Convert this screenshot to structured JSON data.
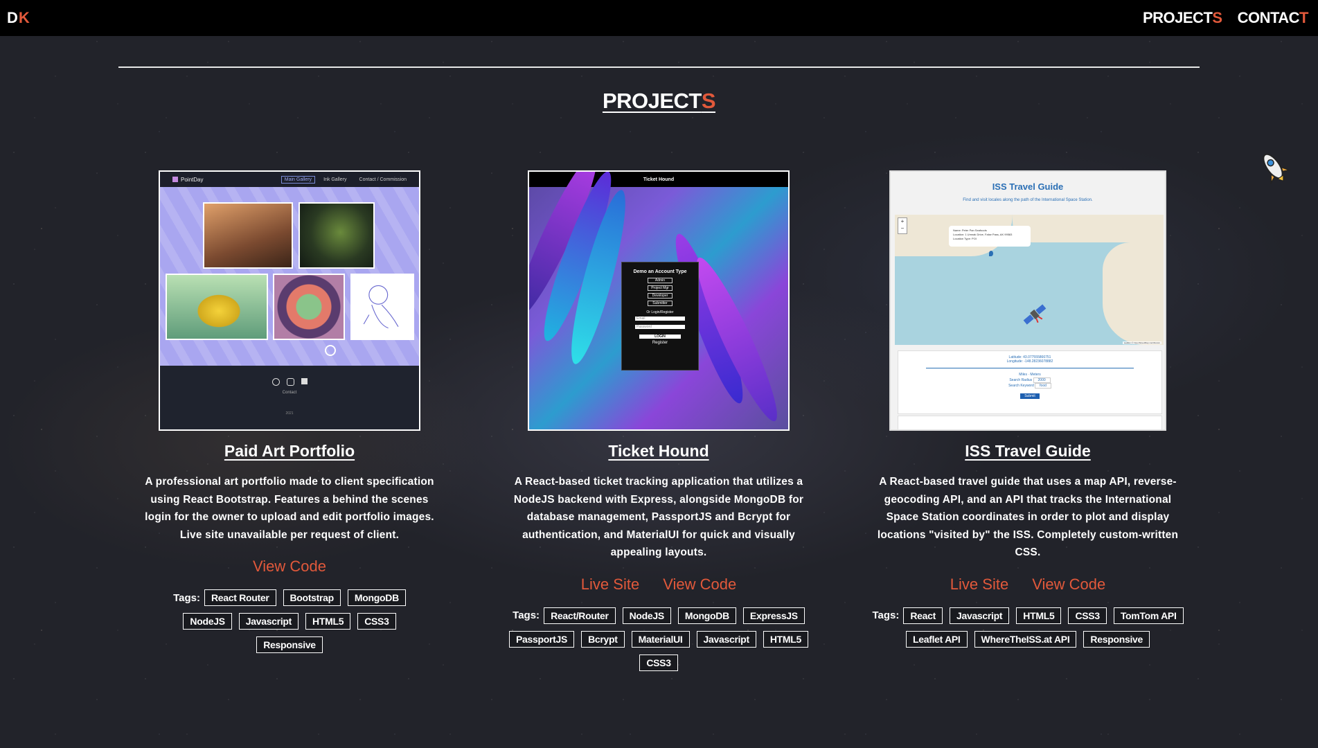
{
  "nav": {
    "logo_first": "D",
    "logo_second": "K",
    "projects_main": "PROJECT",
    "projects_end": "S",
    "contact_main": "CONTAC",
    "contact_end": "T"
  },
  "section": {
    "title_main": "PROJECT",
    "title_end": "S"
  },
  "colors": {
    "accent": "#e2593b",
    "nav_bg": "#000000",
    "background": "#22232a"
  },
  "tags_label": "Tags:",
  "projects": [
    {
      "title": "Paid Art Portfolio",
      "description": "A professional art portfolio made to client specification using React Bootstrap. Features a behind the scenes login for the owner to upload and edit portfolio images. Live site unavailable per request of client.",
      "links": [
        "View Code"
      ],
      "tags": [
        "React Router",
        "Bootstrap",
        "MongoDB",
        "NodeJS",
        "Javascript",
        "HTML5",
        "CSS3",
        "Responsive"
      ],
      "screenshot": {
        "brand": "PointDay",
        "nav": [
          "Main Gallery",
          "Ink Gallery",
          "Contact / Commission"
        ],
        "footer_text": "Contact",
        "footer_small": "2021"
      }
    },
    {
      "title": "Ticket Hound",
      "description": "A React-based ticket tracking application that utilizes a NodeJS backend with Express, alongside MongoDB for database management, PassportJS and Bcrypt for authentication, and MaterialUI for quick and visually appealing layouts.",
      "links": [
        "Live Site",
        "View Code"
      ],
      "tags": [
        "React/Router",
        "NodeJS",
        "MongoDB",
        "ExpressJS",
        "PassportJS",
        "Bcrypt",
        "MaterialUI",
        "Javascript",
        "HTML5",
        "CSS3"
      ],
      "screenshot": {
        "header": "Ticket Hound",
        "demo_title": "Demo an Account Type",
        "roles": [
          "Admin",
          "Project Mgr",
          "Developer",
          "Submitter"
        ],
        "or_text": "Or Login/Register",
        "email_placeholder": "Email",
        "password_placeholder": "Password",
        "login": "LOGIN",
        "register": "Register"
      }
    },
    {
      "title": "ISS Travel Guide",
      "description": "A React-based travel guide that uses a map API, reverse-geocoding API, and an API that tracks the International Space Station coordinates in order to plot and display locations \"visited by\" the ISS. Completely custom-written CSS.",
      "links": [
        "Live Site",
        "View Code"
      ],
      "tags": [
        "React",
        "Javascript",
        "HTML5",
        "CSS3",
        "TomTom API",
        "Leaflet API",
        "WhereTheISS.at API",
        "Responsive"
      ],
      "screenshot": {
        "title": "ISS Travel Guide",
        "subtitle": "Find and visit locales along the path of the International Space Station.",
        "popup_name": "Name: Peter Pan Seafoods",
        "popup_location": "Location: 1 Umnak Drive, False Pass, AK 99583",
        "popup_type": "Location Type: POI",
        "latitude": "Latitude: 43.077555866751",
        "longitude": "Longitude: -148.28236078882",
        "units_miles": "Miles",
        "units_meters": "Meters",
        "radius_label": "Search Radius",
        "radius_value": "2000",
        "keyword_label": "Search Keyword",
        "keyword_value": "food",
        "submit": "Submit",
        "attribution": "Leaflet | © OpenStreetMap contributors"
      }
    }
  ]
}
